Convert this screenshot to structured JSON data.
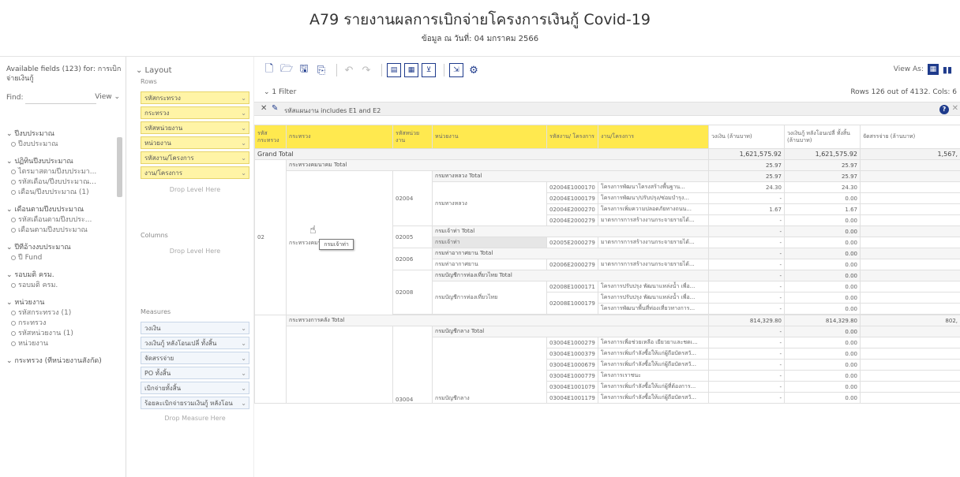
{
  "header": {
    "title": "A79 รายงานผลการเบิกจ่ายโครงการเงินกู้ Covid-19",
    "subtitle": "ข้อมูล ณ วันที่: 04 มกราคม 2566"
  },
  "fields": {
    "title": "Available fields (123) for: การเบิกจ่ายเงินกู้",
    "find_label": "Find:",
    "find_value": "",
    "view_label": "View ⌄",
    "groups": [
      {
        "label": "⌄ ปีงบประมาณ",
        "items": [
          "ปีงบประมาณ"
        ]
      },
      {
        "label": "⌄ ปฏิทินปีงบประมาณ",
        "items": [
          "ไตรมาสตามปีงบประมา...",
          "รหัสเดือน/ปีงบประมาณ...",
          "เดือน/ปีงบประมาณ (1)"
        ]
      },
      {
        "label": "⌄ เดือนตามปีงบประมาณ",
        "items": [
          "รหัสเดือนตามปีงบประ...",
          "เดือนตามปีงบประมาณ"
        ]
      },
      {
        "label": "⌄ ปีที่อ้างงบประมาณ",
        "items": [
          "ปี Fund"
        ]
      },
      {
        "label": "⌄ รอบมติ ครม.",
        "items": [
          "รอบมติ ครม."
        ]
      },
      {
        "label": "⌄ หน่วยงาน",
        "items": [
          "รหัสกระทรวง (1)",
          "กระทรวง",
          "รหัสหน่วยงาน (1)",
          "หน่วยงาน"
        ]
      },
      {
        "label": "⌄ กระทรวง (ที่หน่วยงานสังกัด)",
        "items": []
      }
    ]
  },
  "layout": {
    "title": "⌄ Layout",
    "rows_label": "Rows",
    "rows": [
      "รหัสกระทรวง",
      "กระทรวง",
      "รหัสหน่วยงาน",
      "หน่วยงาน",
      "รหัสงาน/โครงการ",
      "งาน/โครงการ"
    ],
    "drop_level": "Drop Level Here",
    "columns_label": "Columns",
    "measures_label": "Measures",
    "measures": [
      "วงเงิน",
      "วงเงินกู้ หลังโอนเปลี่ ทั้งสิ้น",
      "จัดสรรจ่าย",
      "PO ทั้งสิ้น",
      "เบิกจ่ายทั้งสิ้น",
      "ร้อยละเบิกจ่ายรวมเงินกู้ หลังโอน"
    ],
    "drop_measure": "Drop Measure Here"
  },
  "toolbar": {
    "view_as": "View As:",
    "filter_count": "⌄ 1 Filter",
    "rows_info": "Rows 126 out of 4132. Cols: 6",
    "filter_text": "รหัสแผนงาน includes E1 and E2"
  },
  "table": {
    "headers": [
      "รหัส กระทรวง",
      "กระทรวง",
      "รหัสหน่วย งาน",
      "หน่วยงาน",
      "รหัสงาน/ โครงการ",
      "งาน/โครงการ",
      "วงเงิน (ล้านบาท)",
      "วงเงินกู้ หลังโอนเปลี่ ทั้งสิ้น (ล้านบาท)",
      "จัดสรรจ่าย (ล้านบาท)"
    ],
    "grand_total": {
      "label": "Grand Total",
      "v1": "1,621,575.92",
      "v2": "1,621,575.92",
      "v3": "1,567,"
    },
    "ministry1": {
      "code": "02",
      "name": "กระทรวงคมนาคม",
      "total_label": "กระทรวงคมนาคม Total",
      "v1": "25.97",
      "v2": "25.97"
    },
    "unit_a": {
      "code": "02004",
      "name": "กรมทางหลวง",
      "total_label": "กรมทางหลวง Total",
      "v1": "25.97",
      "v2": "25.97"
    },
    "rows_a": [
      {
        "pc": "02004E1000170",
        "pn": "โครงการพัฒนาโครงสร้างพื้นฐาน...",
        "v1": "24.30",
        "v2": "24.30"
      },
      {
        "pc": "02004E1000179",
        "pn": "โครงการพัฒนา/ปรับปรุง/ซ่อมบำรุง...",
        "v1": "-",
        "v2": "0.00"
      },
      {
        "pc": "02004E2000270",
        "pn": "โครงการเพิ่มความปลอดภัยทางถนน...",
        "v1": "1.67",
        "v2": "1.67"
      },
      {
        "pc": "02004E2000279",
        "pn": "มาตรการการสร้างงานกระจายรายได้...",
        "v1": "-",
        "v2": "0.00"
      }
    ],
    "unit_b": {
      "code": "02005",
      "name": "กรมเจ้าท่า",
      "total_label": "กรมเจ้าท่า Total",
      "v2": "0.00"
    },
    "rows_b": [
      {
        "pc": "02005E2000279",
        "pn": "มาตรการการสร้างงานกระจายรายได้...",
        "v1": "-",
        "v2": "0.00"
      }
    ],
    "unit_c": {
      "code": "02006",
      "name": "กรมท่าอากาศยาน",
      "total_label": "กรมท่าอากาศยาน Total",
      "v2": "0.00"
    },
    "rows_c": [
      {
        "pc": "02006E2000279",
        "pn": "มาตรการการสร้างงานกระจายรายได้...",
        "v1": "-",
        "v2": "0.00"
      }
    ],
    "unit_d": {
      "code": "02008",
      "name": "กรมบัญชีการท่องเที่ยวไทย",
      "total_label": "กรมบัญชีการท่องเที่ยวไทย Total",
      "v2": "0.00"
    },
    "rows_d": [
      {
        "pc": "02008E1000171",
        "pn": "โครงการปรับปรุง พัฒนาแหล่งน้ำ เพื่อ...",
        "v1": "-",
        "v2": "0.00"
      },
      {
        "pc": "02008E1000179",
        "pn": "โครงการปรับปรุง พัฒนาแหล่งน้ำ เพื่อ...",
        "v1": "-",
        "v2": "0.00"
      },
      {
        "pc": "",
        "pn": "โครงการพัฒนาพื้นที่ท่องเที่ยวทางการ...",
        "v1": "-",
        "v2": "0.00"
      }
    ],
    "ministry2": {
      "name": "กระทรวงการคลัง",
      "total_label": "กระทรวงการคลัง Total",
      "v1": "814,329.80",
      "v2": "814,329.80",
      "v3": "802,"
    },
    "unit_e": {
      "code": "03004",
      "name": "กรมบัญชีกลาง",
      "total_label": "กรมบัญชีกลาง Total",
      "v2": "0.00"
    },
    "rows_e": [
      {
        "pc": "03004E1000279",
        "pn": "โครงการเพื่อช่วยเหลือ เยียวยาและชดเ...",
        "v1": "-",
        "v2": "0.00"
      },
      {
        "pc": "03004E1000379",
        "pn": "โครงการเพิ่มกำลังซื้อให้แก่ผู้ถือบัตรสวั...",
        "v1": "-",
        "v2": "0.00"
      },
      {
        "pc": "03004E1000679",
        "pn": "โครงการเพิ่มกำลังซื้อให้แก่ผู้ถือบัตรสวั...",
        "v1": "-",
        "v2": "0.00"
      },
      {
        "pc": "03004E1000779",
        "pn": "โครงการเราชนะ",
        "v1": "-",
        "v2": "0.00"
      },
      {
        "pc": "03004E1001079",
        "pn": "โครงการเพิ่มกำลังซื้อให้แก่ผู้ที่ต้องการ...",
        "v1": "-",
        "v2": "0.00"
      },
      {
        "pc": "03004E1001179",
        "pn": "โครงการเพิ่มกำลังซื้อให้แก่ผู้ถือบัตรสวั...",
        "v1": "-",
        "v2": "0.00"
      }
    ],
    "tooltip": "กรมเจ้าท่า"
  }
}
